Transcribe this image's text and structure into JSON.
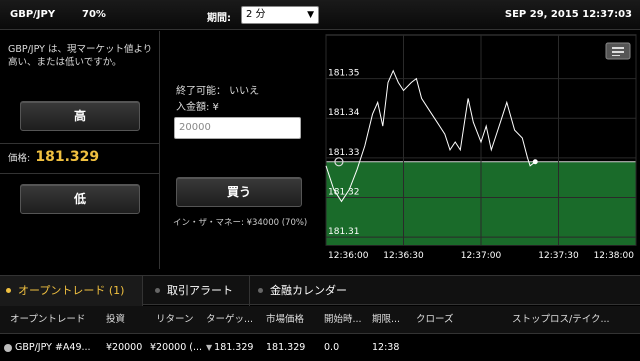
{
  "header": {
    "pair": "GBP/JPY",
    "percent": "70%",
    "period_label": "期間:",
    "period_value": "2 分",
    "datetime": "SEP 29, 2015 12:37:03"
  },
  "left_panel": {
    "description": "GBP/JPY は、現マーケット値より高い、または低いですか。",
    "high_button": "高",
    "price_label": "価格:",
    "price_value": "181.329",
    "low_button": "低"
  },
  "middle_panel": {
    "expiry": "終了可能： いいえ",
    "amount_label": "入金額: ¥",
    "amount_value": "20000",
    "buy_button": "買う",
    "in_the_money": "イン・ザ・マネー: ¥34000 (70%)"
  },
  "chart_data": {
    "type": "line",
    "y_ticks": [
      "181.35",
      "181.34",
      "181.33",
      "181.32",
      "181.31"
    ],
    "x_ticks": [
      "12:36:00",
      "12:36:30",
      "12:37:00",
      "12:37:30",
      "12:38:00"
    ],
    "ylim": [
      181.308,
      181.361
    ],
    "xlim_seconds": [
      0,
      120
    ],
    "entry_price": 181.329,
    "entry_time": "12:36:05",
    "series": [
      {
        "points": [
          [
            0,
            181.328
          ],
          [
            3,
            181.322
          ],
          [
            6,
            181.319
          ],
          [
            9,
            181.322
          ],
          [
            12,
            181.327
          ],
          [
            15,
            181.333
          ],
          [
            18,
            181.341
          ],
          [
            20,
            181.344
          ],
          [
            22,
            181.338
          ],
          [
            24,
            181.349
          ],
          [
            26,
            181.352
          ],
          [
            28,
            181.349
          ],
          [
            30,
            181.347
          ],
          [
            33,
            181.349
          ],
          [
            35,
            181.35
          ],
          [
            37,
            181.345
          ],
          [
            40,
            181.342
          ],
          [
            43,
            181.339
          ],
          [
            46,
            181.336
          ],
          [
            48,
            181.332
          ],
          [
            50,
            181.334
          ],
          [
            52,
            181.332
          ],
          [
            55,
            181.345
          ],
          [
            57,
            181.339
          ],
          [
            60,
            181.334
          ],
          [
            62,
            181.338
          ],
          [
            64,
            181.332
          ],
          [
            66,
            181.336
          ],
          [
            68,
            181.34
          ],
          [
            70,
            181.344
          ],
          [
            73,
            181.337
          ],
          [
            76,
            181.335
          ],
          [
            78,
            181.33
          ],
          [
            79,
            181.328
          ],
          [
            81,
            181.329
          ]
        ]
      }
    ],
    "colors": {
      "line": "#ffffff",
      "above_zone": "#000000",
      "below_zone": "#1a6b2a",
      "grid": "#2a2a2a"
    }
  },
  "tabs": [
    {
      "label": "オープントレード (1)",
      "active": true
    },
    {
      "label": "取引アラート",
      "active": false
    },
    {
      "label": "金融カレンダー",
      "active": false
    }
  ],
  "table": {
    "headers": [
      "オープントレード",
      "投資",
      "リターン",
      "ターゲッ...",
      "市場価格",
      "開始時...",
      "期限...",
      "クローズ",
      "ストップロス/テイク..."
    ],
    "row": {
      "pair": "GBP/JPY #A49...",
      "investment": "¥20000",
      "return": "¥20000 (...",
      "target": "181.329",
      "market_price": "181.329",
      "start": "0.0",
      "expiry": "12:38",
      "close": "",
      "stop": ""
    }
  }
}
